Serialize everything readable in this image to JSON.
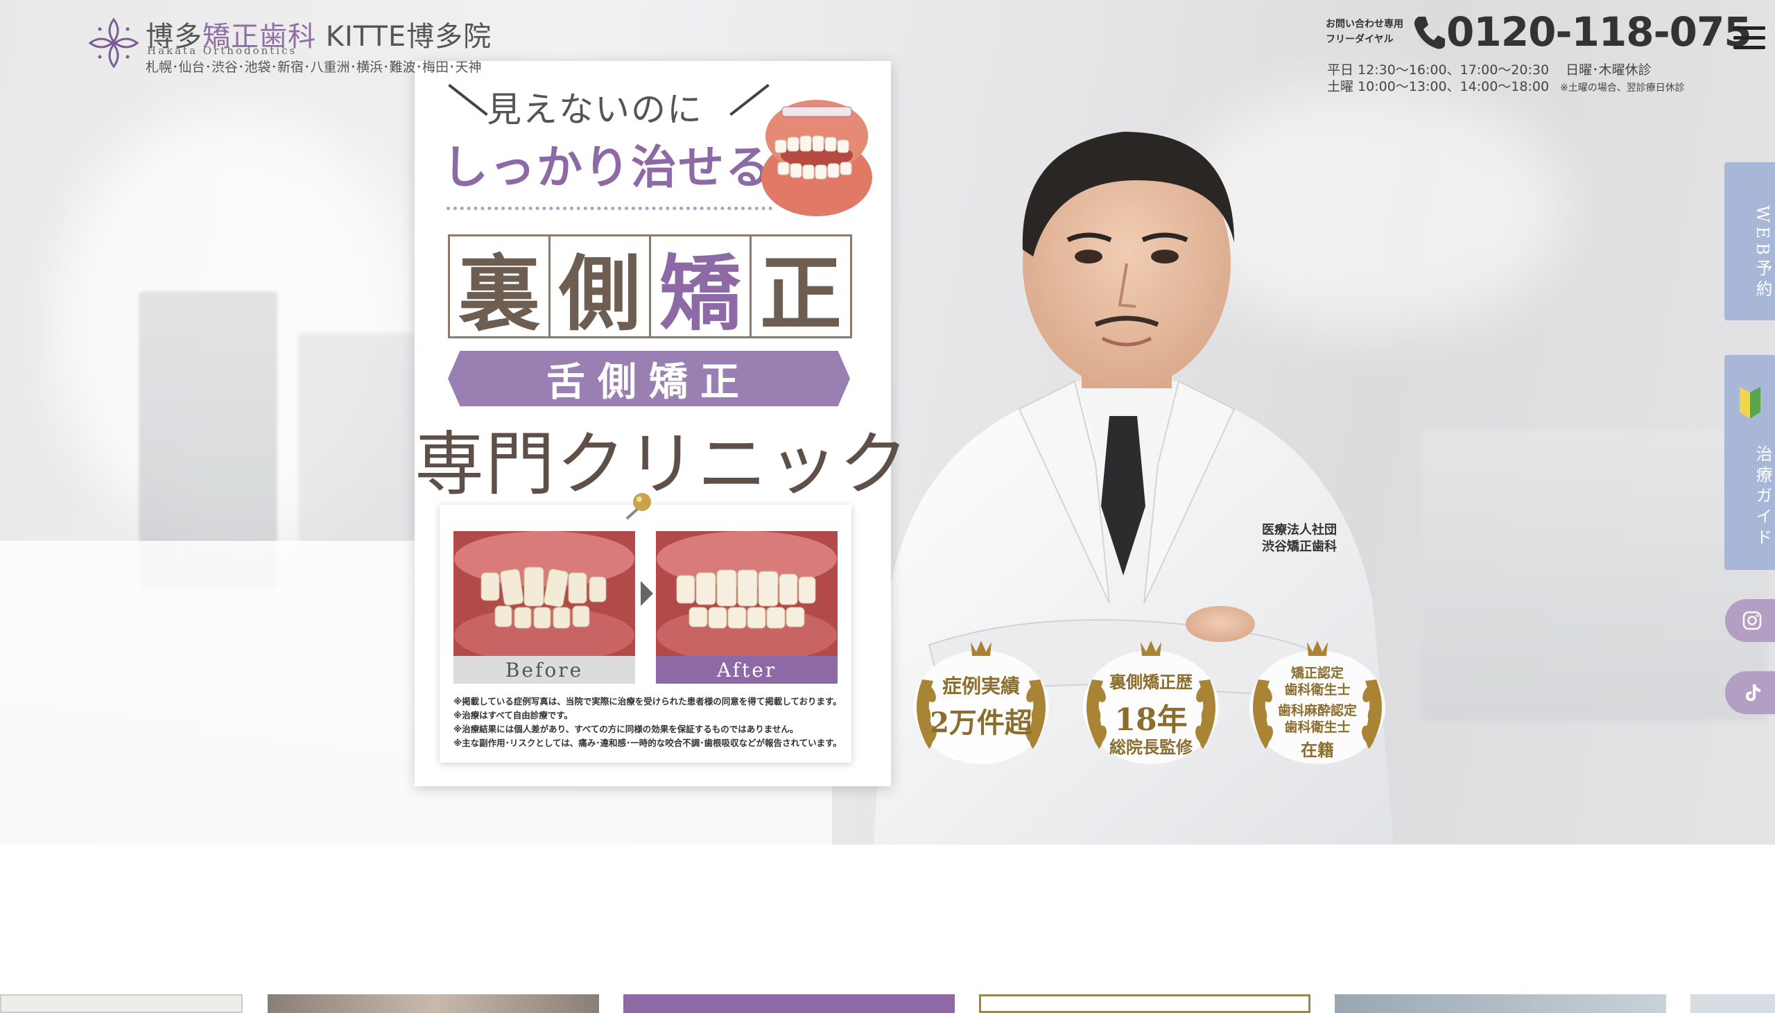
{
  "header": {
    "logo_title_pre": "博多",
    "logo_title_accent": "矯正歯科",
    "logo_title_post": " KITTE博多院",
    "logo_en": "Hakata Orthodontics",
    "logo_branches": "札幌･仙台･渋谷･池袋･新宿･八重洲･横浜･難波･梅田･天神",
    "contact_label_1": "お問い合わせ専用",
    "contact_label_2": "フリーダイヤル",
    "phone": "0120-118-075",
    "hours_weekday": "平日 12:30〜16:00、17:00〜20:30",
    "closed_days": "日曜･木曜休診",
    "hours_saturday": "土曜 10:00〜13:00、14:00〜18:00",
    "closed_note": "※土曜の場合、翌診療日休診"
  },
  "side_tabs": {
    "web_booking": "WEB予約",
    "treatment_guide": "治療ガイド"
  },
  "poster": {
    "tagline_1": "見えないのに",
    "tagline_2": "しっかり治せる",
    "kanji": [
      "裏",
      "側",
      "矯",
      "正"
    ],
    "banner": "舌側矯正",
    "clinic": "専門クリニック",
    "before_label": "Before",
    "after_label": "After",
    "disclaimer": [
      "※掲載している症例写真は、当院で実際に治療を受けられた患者様の同意を得て掲載しております。",
      "※治療はすべて自由診療です。",
      "※治療結果には個人差があり、すべての方に同様の効果を保証するものではありません。",
      "※主な副作用･リスクとしては、痛み･違和感･一時的な咬合不調･歯根吸収などが報告されています。"
    ]
  },
  "doctor_coat_text": [
    "医療法人社団",
    "渋谷矯正歯科"
  ],
  "badges": [
    {
      "line1": "症例実績",
      "line2": "2万件超"
    },
    {
      "line1": "裏側矯正歴",
      "line2": "18年",
      "line3": "総院長監修"
    },
    {
      "line1": "矯正認定",
      "line2": "歯科衛生士",
      "line3": "歯科麻酔認定",
      "line4": "歯科衛生士",
      "line5": "在籍"
    }
  ],
  "colors": {
    "accent_purple": "#8d6aa5",
    "tab_blue": "#a8b6d8",
    "sns_purple": "#b49fc4",
    "badge_gold": "#8b6d2e"
  },
  "icons": [
    "logo-flower-icon",
    "phone-icon",
    "hamburger-menu-icon",
    "beginner-mark-icon",
    "instagram-icon",
    "tiktok-icon"
  ]
}
